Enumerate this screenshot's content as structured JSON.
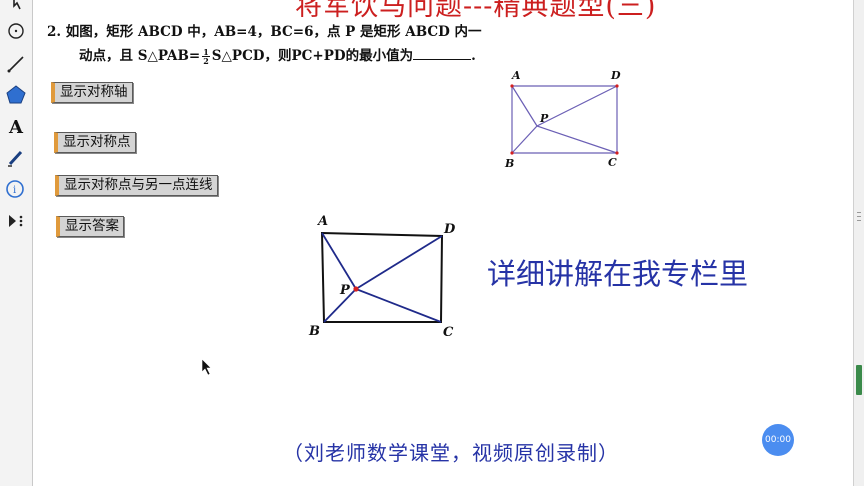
{
  "title": "将军饮马问题---精典题型(三)",
  "problem": {
    "line1": "2. 如图，矩形 ABCD 中，AB=4，BC=6，点 P 是矩形 ABCD 内一",
    "line2_a": "动点，且 S△PAB=",
    "frac_num": "1",
    "frac_den": "2",
    "line2_b": "S△PCD，则PC+PD的最小值为",
    "line2_end": "."
  },
  "buttons": [
    {
      "label": "显示对称轴"
    },
    {
      "label": "显示对称点"
    },
    {
      "label": "显示对称点与另一点连线"
    },
    {
      "label": "显示答案"
    }
  ],
  "small_figure": {
    "A": "A",
    "B": "B",
    "C": "C",
    "D": "D",
    "P": "P",
    "line_color": "#6b5fb5"
  },
  "large_figure": {
    "A": "A",
    "B": "B",
    "C": "C",
    "D": "D",
    "P": "P",
    "line_color": "#1f2a8a",
    "point_color": "#d42020"
  },
  "promo_text": "详细讲解在我专栏里",
  "footer_text": "（刘老师数学课堂，视频原创录制）",
  "timer": "00:00",
  "colors": {
    "title": "#cc1f1f",
    "blue_text": "#2633a6",
    "button_accent": "#e09a3c"
  }
}
